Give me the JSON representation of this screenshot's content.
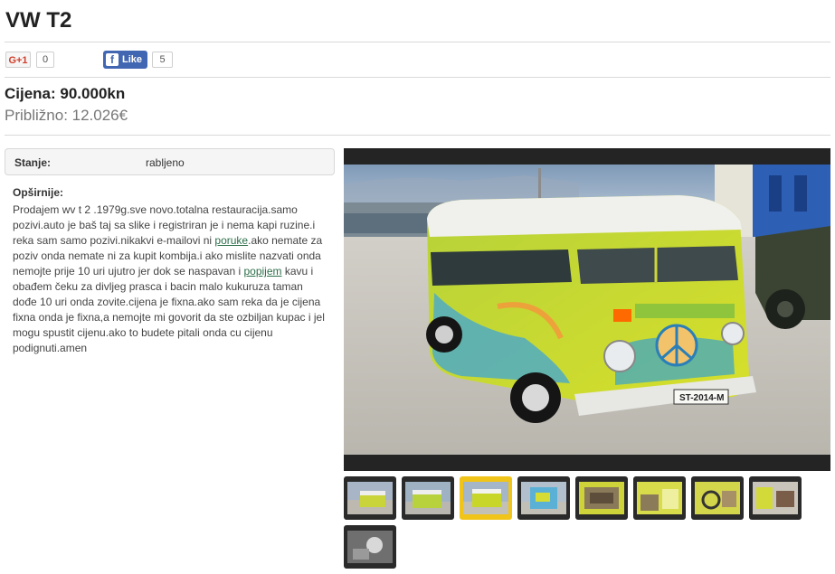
{
  "listing": {
    "title": "VW T2",
    "price": "Cijena: 90.000kn",
    "price_approx": "Približno: 12.026€"
  },
  "social": {
    "gplus_label": "G+1",
    "gplus_count": "0",
    "fb_like_label": "Like",
    "fb_like_count": "5"
  },
  "details": {
    "stanje_label": "Stanje:",
    "stanje_value": "rabljeno",
    "description_label": "Opširnije:",
    "description_parts": [
      "Prodajem wv t 2 .1979g.sve novo.totalna restauracija.samo pozivi.auto je baš taj sa slike i registriran je i nema kapi ruzine.i reka sam samo pozivi.nikakvi e-mailovi ni ",
      "poruke",
      ".ako nemate za poziv onda nemate ni za kupit kombija.i ako mislite nazvati onda nemojte prije 10 uri ujutro jer dok se naspavan i ",
      "popijem",
      " kavu i obađem čeku za divljeg prasca i bacin malo kukuruza taman dođe 10 uri onda zovite.cijena je fixna.ako sam reka da je cijena fixna onda je fixna,a nemojte mi govorit da ste ozbiljan kupac i jel mogu spustit cijenu.ako to budete pitali onda cu cijenu podignuti.amen"
    ]
  },
  "gallery": {
    "main_plate": "ST-2014-M",
    "thumbnail_count": 9,
    "active_thumbnail": 3
  },
  "colors": {
    "van_body": "#c8d62a",
    "van_roof": "#f2f2ee",
    "sky": "#9eb4cc",
    "ground": "#c6c3bc",
    "active_thumb": "#f0c419",
    "link": "#2c6e49",
    "facebook": "#4267b2"
  }
}
